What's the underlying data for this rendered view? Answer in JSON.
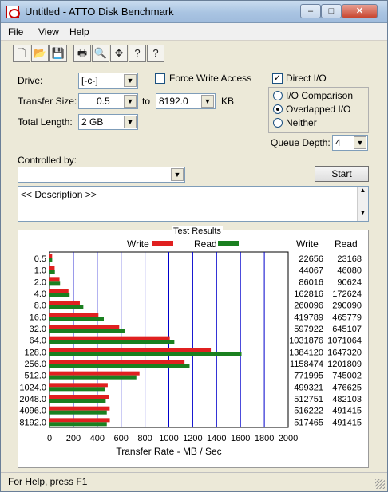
{
  "window": {
    "title": "Untitled - ATTO Disk Benchmark",
    "minimize": "–",
    "maximize": "□",
    "close": "✕"
  },
  "menu": [
    "File",
    "View",
    "Help"
  ],
  "toolbar_icons": [
    "new-icon",
    "open-icon",
    "save-icon",
    "print-icon",
    "print-preview-icon",
    "move-icon",
    "help-icon",
    "context-help-icon"
  ],
  "toolbar_glyphs": [
    "🗋",
    "📂",
    "💾",
    "🖶",
    "🔍",
    "✥",
    "?",
    "?"
  ],
  "drive": {
    "label": "Drive:",
    "value": "[-c-]"
  },
  "force_write": {
    "label": "Force Write Access",
    "checked": false
  },
  "direct_io": {
    "label": "Direct I/O",
    "checked": true,
    "mark": "✓"
  },
  "transfer_size": {
    "label": "Transfer Size:",
    "from": "0.5",
    "to_label": "to",
    "to": "8192.0",
    "unit": "KB"
  },
  "total_length": {
    "label": "Total Length:",
    "value": "2 GB"
  },
  "io_mode": {
    "options": [
      "I/O Comparison",
      "Overlapped I/O",
      "Neither"
    ],
    "selected": "Overlapped I/O"
  },
  "queue_depth": {
    "label": "Queue Depth:",
    "value": "4"
  },
  "controlled_by": {
    "label": "Controlled by:",
    "value": ""
  },
  "start_button": "Start",
  "description": "<< Description >>",
  "status": "For Help, press F1",
  "chart_data": {
    "type": "bar",
    "title": "Test Results",
    "xlabel": "Transfer Rate - MB / Sec",
    "xlim": [
      0,
      2000
    ],
    "xticks": [
      0,
      200,
      400,
      600,
      800,
      1000,
      1200,
      1400,
      1600,
      1800,
      2000
    ],
    "legend": [
      "Write",
      "Read"
    ],
    "colors": {
      "write": "#e02020",
      "read": "#1a8020",
      "grid": "#0000cc"
    },
    "column_headers": [
      "Write",
      "Read"
    ],
    "categories": [
      "0.5",
      "1.0",
      "2.0",
      "4.0",
      "8.0",
      "16.0",
      "32.0",
      "64.0",
      "128.0",
      "256.0",
      "512.0",
      "1024.0",
      "2048.0",
      "4096.0",
      "8192.0"
    ],
    "series": [
      {
        "name": "Write",
        "values": [
          22656,
          44067,
          86016,
          162816,
          260096,
          419789,
          597922,
          1031876,
          1384120,
          1158474,
          771995,
          499321,
          512751,
          516222,
          517465
        ]
      },
      {
        "name": "Read",
        "values": [
          23168,
          46080,
          90624,
          172624,
          290090,
          465779,
          645107,
          1071064,
          1647320,
          1201809,
          745002,
          476625,
          482103,
          491415,
          491415
        ]
      }
    ]
  }
}
